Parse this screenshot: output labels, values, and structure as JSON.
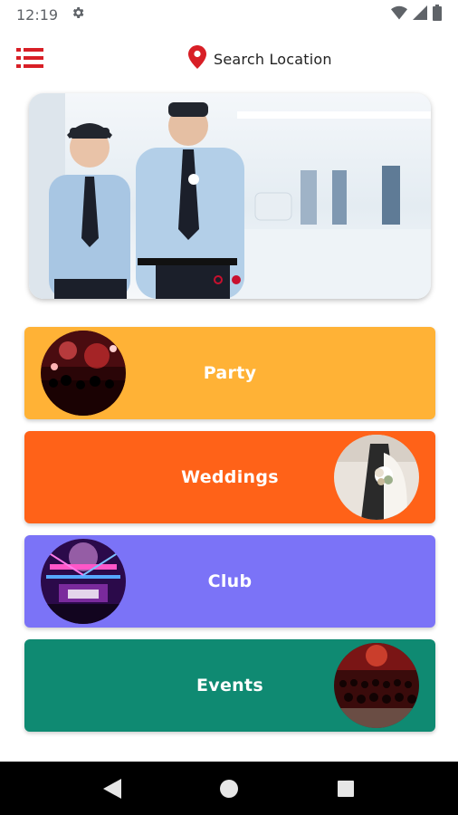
{
  "status_bar": {
    "time": "12:19",
    "icons": [
      "gear-icon",
      "wifi-icon",
      "signal-icon",
      "battery-icon"
    ]
  },
  "header": {
    "menu_icon": "hamburger-menu-icon",
    "location_icon": "map-pin-icon",
    "location_label": "Search Location"
  },
  "banner": {
    "slide_count": 2,
    "active_slide": 2
  },
  "categories": [
    {
      "label": "Party",
      "color": "#FFB236",
      "image_side": "left"
    },
    {
      "label": "Weddings",
      "color": "#FF6218",
      "image_side": "right"
    },
    {
      "label": "Club",
      "color": "#7B73F7",
      "image_side": "left"
    },
    {
      "label": "Events",
      "color": "#0F8A72",
      "image_side": "right"
    }
  ],
  "nav_bar": {
    "buttons": [
      "back-icon",
      "home-icon",
      "recents-icon"
    ]
  },
  "colors": {
    "accent": "#C8102E",
    "status_text": "#5F6368"
  }
}
